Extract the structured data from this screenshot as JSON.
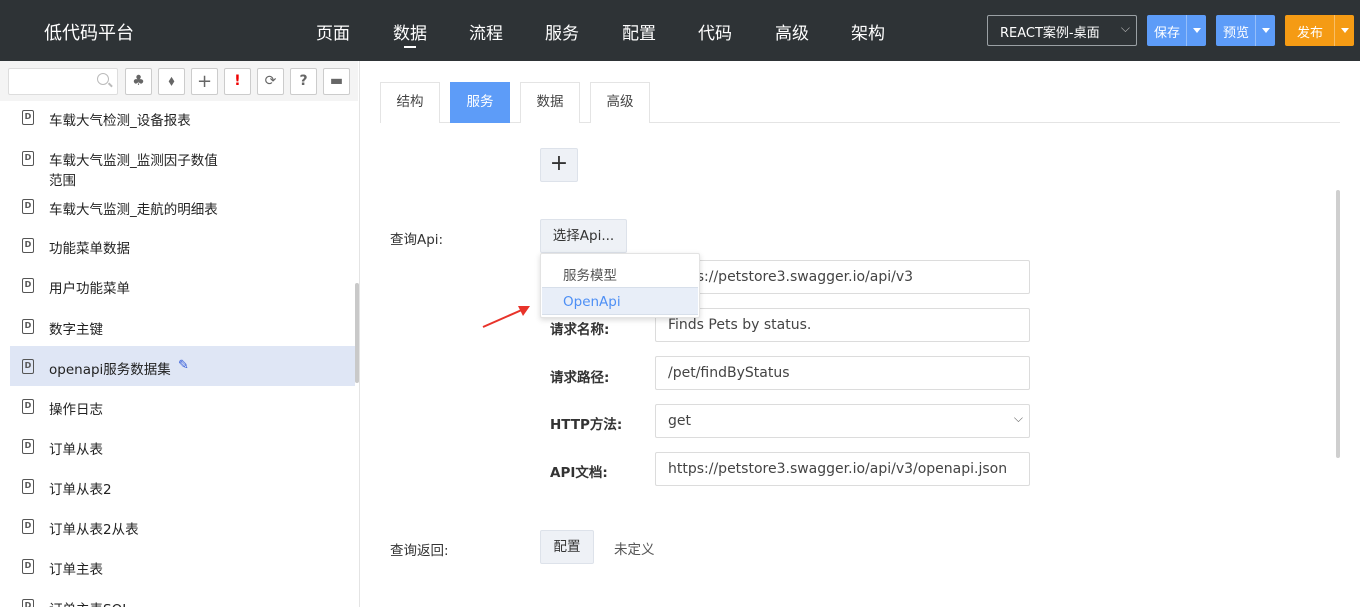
{
  "header": {
    "brand": "低代码平台",
    "nav": [
      "页面",
      "数据",
      "流程",
      "服务",
      "配置",
      "代码",
      "高级",
      "架构"
    ],
    "active_nav": "数据",
    "env_select": "REACT案例-桌面",
    "save_label": "保存",
    "preview_label": "预览",
    "publish_label": "发布",
    "colors": {
      "bar": "#2e3336",
      "save": "#5d9cf8",
      "publish": "#f59b14"
    }
  },
  "sidebar": {
    "search_placeholder": "",
    "tools": [
      "tree-icon",
      "tag-icon",
      "add-icon",
      "alert-icon",
      "refresh-icon",
      "help-icon",
      "comment-icon"
    ],
    "tool_glyphs": [
      "♣",
      "⬧",
      "+",
      "!",
      "⟳",
      "?",
      "▬"
    ],
    "items": [
      {
        "label": "车载大气检测_设备报表"
      },
      {
        "label": "车载大气监测_监测因子数值",
        "label2": "范围"
      },
      {
        "label": "车载大气监测_走航的明细表"
      },
      {
        "label": "功能菜单数据"
      },
      {
        "label": "用户功能菜单"
      },
      {
        "label": "数字主键"
      },
      {
        "label": "openapi服务数据集",
        "selected": true
      },
      {
        "label": "操作日志"
      },
      {
        "label": "订单从表"
      },
      {
        "label": "订单从表2"
      },
      {
        "label": "订单从表2从表"
      },
      {
        "label": "订单主表"
      },
      {
        "label": "订单主表SQL"
      }
    ],
    "doc_icon_letter": "D"
  },
  "main": {
    "tabs": [
      "结构",
      "服务",
      "数据",
      "高级"
    ],
    "active_tab": "服务",
    "add_label": "+",
    "query_api_label": "查询Api:",
    "select_api_label": "选择Api...",
    "dropdown": {
      "items": [
        "服务模型",
        "OpenApi"
      ],
      "highlighted": "OpenApi"
    },
    "fields": {
      "base_url_value": "https://petstore3.swagger.io/api/v3",
      "request_name_label": "请求名称:",
      "request_name_value": "Finds Pets by status.",
      "request_path_label": "请求路径:",
      "request_path_value": "/pet/findByStatus",
      "http_method_label": "HTTP方法:",
      "http_method_value": "get",
      "api_doc_label": "API文档:",
      "api_doc_value": "https://petstore3.swagger.io/api/v3/openapi.json"
    },
    "query_return_label": "查询返回:",
    "config_label": "配置",
    "undefined_label": "未定义"
  }
}
